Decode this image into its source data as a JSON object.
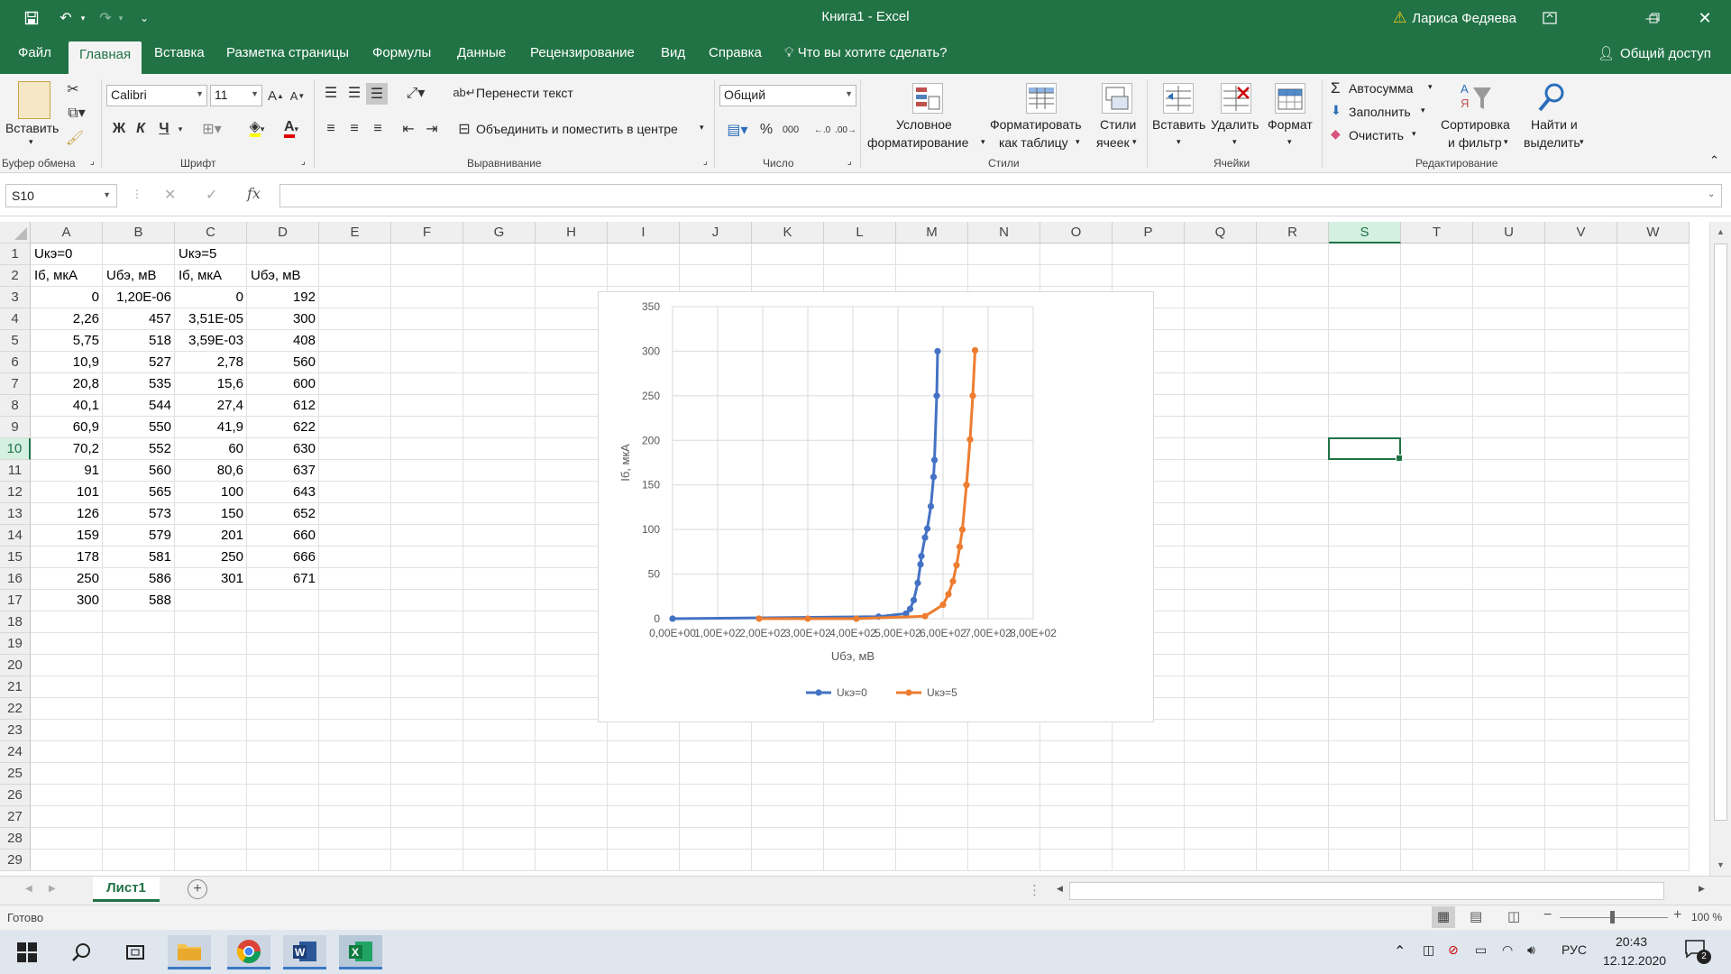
{
  "app": {
    "title": "Книга1  -  Excel",
    "user": "Лариса Федяева",
    "share": "Общий доступ"
  },
  "tabs": [
    "Файл",
    "Главная",
    "Вставка",
    "Разметка страницы",
    "Формулы",
    "Данные",
    "Рецензирование",
    "Вид",
    "Справка",
    "Что вы хотите сделать?"
  ],
  "ribbon": {
    "clipboard": {
      "paste": "Вставить",
      "label": "Буфер обмена"
    },
    "font": {
      "name": "Calibri",
      "size": "11",
      "label": "Шрифт",
      "bold": "Ж",
      "italic": "К",
      "underline": "Ч"
    },
    "alignment": {
      "wrap": "Перенести текст",
      "merge": "Объединить и поместить в центре",
      "label": "Выравнивание"
    },
    "number": {
      "format": "Общий",
      "percent": "%",
      "thousands": "000",
      "label": "Число"
    },
    "styles": {
      "conditional_1": "Условное",
      "conditional_2": "форматирование",
      "as_table_1": "Форматировать",
      "as_table_2": "как таблицу",
      "cell_styles_1": "Стили",
      "cell_styles_2": "ячеек",
      "label": "Стили"
    },
    "cells": {
      "insert": "Вставить",
      "delete": "Удалить",
      "format": "Формат",
      "label": "Ячейки"
    },
    "editing": {
      "autosum": "Автосумма",
      "fill": "Заполнить",
      "clear": "Очистить",
      "sort_1": "Сортировка",
      "sort_2": "и фильтр",
      "find_1": "Найти и",
      "find_2": "выделить",
      "label": "Редактирование"
    }
  },
  "formula_bar": {
    "name_box": "S10",
    "formula": "",
    "fx": "fx"
  },
  "columns": [
    "A",
    "B",
    "C",
    "D",
    "E",
    "F",
    "G",
    "H",
    "I",
    "J",
    "K",
    "L",
    "M",
    "N",
    "O",
    "P",
    "Q",
    "R",
    "S",
    "T",
    "U",
    "V",
    "W"
  ],
  "rows": [
    "1",
    "2",
    "3",
    "4",
    "5",
    "6",
    "7",
    "8",
    "9",
    "10",
    "11",
    "12",
    "13",
    "14",
    "15",
    "16",
    "17",
    "18",
    "19",
    "20",
    "21",
    "22",
    "23",
    "24",
    "25",
    "26",
    "27",
    "28",
    "29"
  ],
  "selected": {
    "column": "S",
    "row": "10"
  },
  "cells": {
    "header_row1": [
      "Uкэ=0",
      "",
      "Uкэ=5",
      ""
    ],
    "header_row2": [
      "Iб, мкА",
      "Uбэ, мВ",
      "Iб, мкА",
      "Uбэ, мВ"
    ],
    "data": [
      [
        "0",
        "1,20E-06",
        "0",
        "192"
      ],
      [
        "2,26",
        "457",
        "3,51E-05",
        "300"
      ],
      [
        "5,75",
        "518",
        "3,59E-03",
        "408"
      ],
      [
        "10,9",
        "527",
        "2,78",
        "560"
      ],
      [
        "20,8",
        "535",
        "15,6",
        "600"
      ],
      [
        "40,1",
        "544",
        "27,4",
        "612"
      ],
      [
        "60,9",
        "550",
        "41,9",
        "622"
      ],
      [
        "70,2",
        "552",
        "60",
        "630"
      ],
      [
        "91",
        "560",
        "80,6",
        "637"
      ],
      [
        "101",
        "565",
        "100",
        "643"
      ],
      [
        "126",
        "573",
        "150",
        "652"
      ],
      [
        "159",
        "579",
        "201",
        "660"
      ],
      [
        "178",
        "581",
        "250",
        "666"
      ],
      [
        "250",
        "586",
        "301",
        "671"
      ],
      [
        "300",
        "588",
        "",
        ""
      ]
    ]
  },
  "chart_data": {
    "type": "scatter",
    "title": "",
    "xlabel": "Uбэ, мВ",
    "ylabel": "Iб, мкА",
    "xlim": [
      0,
      800
    ],
    "ylim": [
      0,
      350
    ],
    "x_ticks": [
      "0,00E+00",
      "1,00E+02",
      "2,00E+02",
      "3,00E+02",
      "4,00E+02",
      "5,00E+02",
      "6,00E+02",
      "7,00E+02",
      "8,00E+02"
    ],
    "y_ticks": [
      "0",
      "50",
      "100",
      "150",
      "200",
      "250",
      "300",
      "350"
    ],
    "grid": true,
    "legend": "bottom",
    "series": [
      {
        "name": "Uкэ=0",
        "color": "#4472C4",
        "x": [
          1.2e-06,
          457,
          518,
          527,
          535,
          544,
          550,
          552,
          560,
          565,
          573,
          579,
          581,
          586,
          588
        ],
        "y": [
          0,
          2.26,
          5.75,
          10.9,
          20.8,
          40.1,
          60.9,
          70.2,
          91,
          101,
          126,
          159,
          178,
          250,
          300
        ]
      },
      {
        "name": "Uкэ=5",
        "color": "#ED7D31",
        "x": [
          192,
          300,
          408,
          560,
          600,
          612,
          622,
          630,
          637,
          643,
          652,
          660,
          666,
          671
        ],
        "y": [
          0,
          3.51e-05,
          0.00359,
          2.78,
          15.6,
          27.4,
          41.9,
          60,
          80.6,
          100,
          150,
          201,
          250,
          301
        ]
      }
    ]
  },
  "sheet": {
    "tab": "Лист1"
  },
  "status": {
    "ready": "Готово",
    "zoom": "100 %"
  },
  "taskbar": {
    "lang": "РУС",
    "time": "20:43",
    "date": "12.12.2020",
    "notifications": "2"
  }
}
